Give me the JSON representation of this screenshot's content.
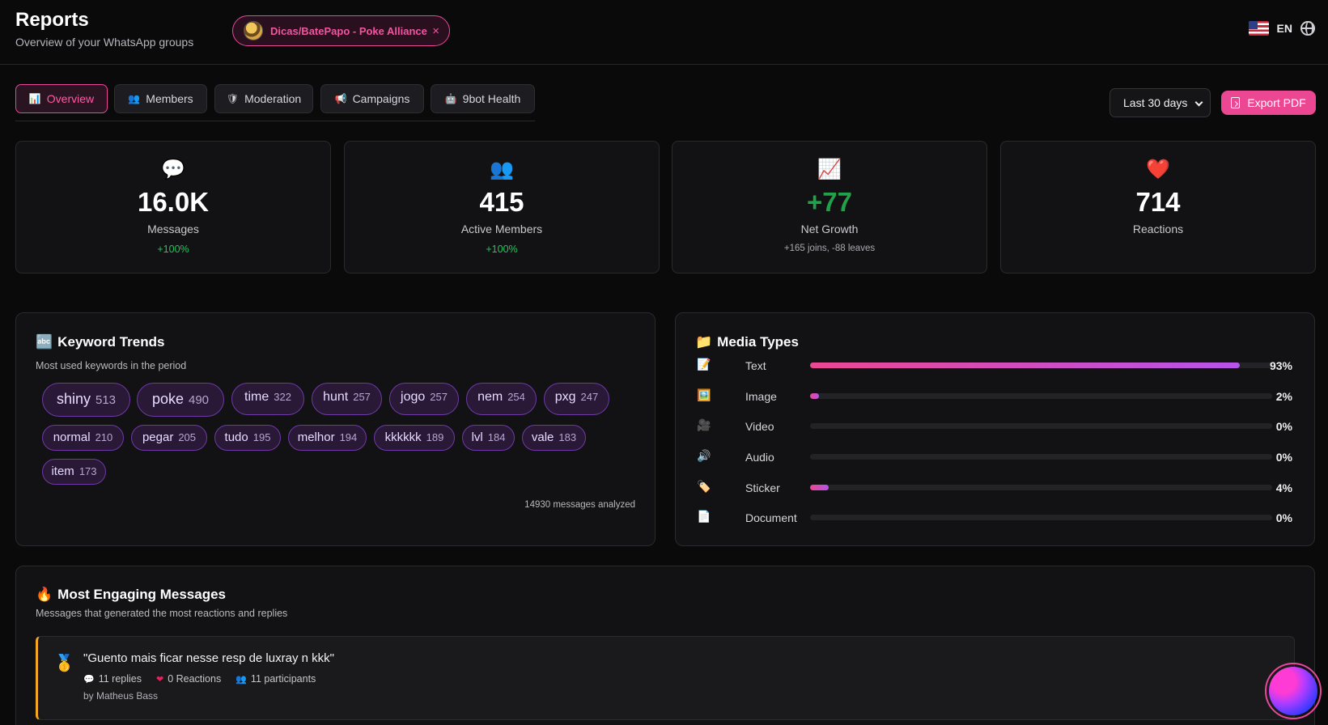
{
  "header": {
    "title": "Reports",
    "subtitle": "Overview of your WhatsApp groups",
    "group": "Dicas/BatePapo - Poke Alliance",
    "close": "×",
    "lang": "EN"
  },
  "tabs": [
    {
      "icon": "📊",
      "label": "Overview",
      "active": true
    },
    {
      "icon": "👥",
      "label": "Members"
    },
    {
      "icon": "🛡",
      "label": "Moderation"
    },
    {
      "icon": "📢",
      "label": "Campaigns"
    },
    {
      "icon": "🤖",
      "label": "9bot Health"
    }
  ],
  "controls": {
    "range": "Last 30 days",
    "export": "Export PDF"
  },
  "stats": [
    {
      "icon": "💬",
      "value": "16.0K",
      "label": "Messages",
      "sub": "+100%"
    },
    {
      "icon": "👥",
      "value": "415",
      "label": "Active Members",
      "sub": "+100%"
    },
    {
      "icon": "📈",
      "value": "+77",
      "label": "Net Growth",
      "sub": "+165 joins, -88 leaves"
    },
    {
      "icon": "❤️",
      "value": "714",
      "label": "Reactions",
      "sub": ""
    }
  ],
  "keywords": {
    "icon": "🔤",
    "title": "Keyword Trends",
    "description": "Most used keywords in the period",
    "items": [
      {
        "word": "shiny",
        "count": "513"
      },
      {
        "word": "poke",
        "count": "490"
      },
      {
        "word": "time",
        "count": "322"
      },
      {
        "word": "hunt",
        "count": "257"
      },
      {
        "word": "jogo",
        "count": "257"
      },
      {
        "word": "nem",
        "count": "254"
      },
      {
        "word": "pxg",
        "count": "247"
      },
      {
        "word": "normal",
        "count": "210"
      },
      {
        "word": "pegar",
        "count": "205"
      },
      {
        "word": "tudo",
        "count": "195"
      },
      {
        "word": "melhor",
        "count": "194"
      },
      {
        "word": "kkkkkk",
        "count": "189"
      },
      {
        "word": "lvl",
        "count": "184"
      },
      {
        "word": "vale",
        "count": "183"
      },
      {
        "word": "item",
        "count": "173"
      }
    ],
    "footer": "14930 messages analyzed"
  },
  "media": {
    "icon": "📁",
    "title": "Media Types",
    "rows": [
      {
        "icon": "📝",
        "label": "Text",
        "pct": "93%",
        "fraction": 0.93
      },
      {
        "icon": "🖼️",
        "label": "Image",
        "pct": "2%",
        "fraction": 0.02
      },
      {
        "icon": "🎥",
        "label": "Video",
        "pct": "0%",
        "fraction": 0
      },
      {
        "icon": "🔊",
        "label": "Audio",
        "pct": "0%",
        "fraction": 0
      },
      {
        "icon": "🏷️",
        "label": "Sticker",
        "pct": "4%",
        "fraction": 0.04
      },
      {
        "icon": "📄",
        "label": "Document",
        "pct": "0%",
        "fraction": 0
      }
    ]
  },
  "engaging": {
    "icon": "🔥",
    "title": "Most Engaging Messages",
    "description": "Messages that generated the most reactions and replies",
    "messages": [
      {
        "medal": "🥇",
        "text": "\"Guento mais ficar nesse resp de luxray n kkk\"",
        "replies": "11 replies",
        "reactions": "0 Reactions",
        "participants": "11 participants",
        "author": "by Matheus Bass"
      }
    ]
  }
}
